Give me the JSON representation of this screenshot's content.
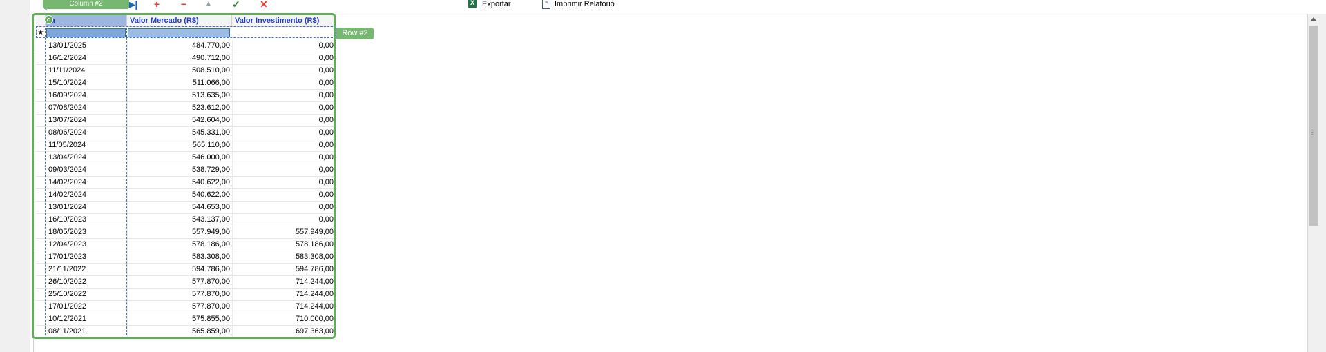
{
  "toolbar": {
    "first_icon": "first-record-icon",
    "last_icon": "last-record-icon",
    "add_icon": "plus-icon",
    "delete_icon": "minus-icon",
    "up_icon": "triangle-up-icon",
    "confirm_icon": "check-icon",
    "cancel_icon": "x-icon",
    "export_label": "Exportar",
    "export_icon_glyph": "X",
    "print_label": "Imprimir Relatório"
  },
  "overlay": {
    "column_label": "Column #2",
    "row_label": "Row #2"
  },
  "grid": {
    "columns": [
      "ta",
      "Valor Mercado (R$)",
      "Valor Investimento (R$)"
    ],
    "new_row_marker": "★",
    "rows": [
      {
        "data": "13/01/2025",
        "mercado": "484.770,00",
        "invest": "0,00"
      },
      {
        "data": "16/12/2024",
        "mercado": "490.712,00",
        "invest": "0,00"
      },
      {
        "data": "11/11/2024",
        "mercado": "508.510,00",
        "invest": "0,00"
      },
      {
        "data": "15/10/2024",
        "mercado": "511.066,00",
        "invest": "0,00"
      },
      {
        "data": "16/09/2024",
        "mercado": "513.635,00",
        "invest": "0,00"
      },
      {
        "data": "07/08/2024",
        "mercado": "523.612,00",
        "invest": "0,00"
      },
      {
        "data": "13/07/2024",
        "mercado": "542.604,00",
        "invest": "0,00"
      },
      {
        "data": "08/06/2024",
        "mercado": "545.331,00",
        "invest": "0,00"
      },
      {
        "data": "11/05/2024",
        "mercado": "565.110,00",
        "invest": "0,00"
      },
      {
        "data": "13/04/2024",
        "mercado": "546.000,00",
        "invest": "0,00"
      },
      {
        "data": "09/03/2024",
        "mercado": "538.729,00",
        "invest": "0,00"
      },
      {
        "data": "14/02/2024",
        "mercado": "540.622,00",
        "invest": "0,00"
      },
      {
        "data": "14/02/2024",
        "mercado": "540.622,00",
        "invest": "0,00"
      },
      {
        "data": "13/01/2024",
        "mercado": "544.653,00",
        "invest": "0,00"
      },
      {
        "data": "16/10/2023",
        "mercado": "543.137,00",
        "invest": "0,00"
      },
      {
        "data": "18/05/2023",
        "mercado": "557.949,00",
        "invest": "557.949,00"
      },
      {
        "data": "12/04/2023",
        "mercado": "578.186,00",
        "invest": "578.186,00"
      },
      {
        "data": "17/01/2023",
        "mercado": "583.308,00",
        "invest": "583.308,00"
      },
      {
        "data": "21/11/2022",
        "mercado": "594.786,00",
        "invest": "594.786,00"
      },
      {
        "data": "26/10/2022",
        "mercado": "577.870,00",
        "invest": "714.244,00"
      },
      {
        "data": "25/10/2022",
        "mercado": "577.870,00",
        "invest": "714.244,00"
      },
      {
        "data": "17/01/2022",
        "mercado": "577.870,00",
        "invest": "714.244,00"
      },
      {
        "data": "10/12/2021",
        "mercado": "575.855,00",
        "invest": "710.000,00"
      },
      {
        "data": "08/11/2021",
        "mercado": "565.859,00",
        "invest": "697.363,00"
      }
    ]
  },
  "colors": {
    "header_text": "#1e3bd1",
    "selection_green": "#62ad5a",
    "selected_cell_blue": "#7fa6d8"
  }
}
